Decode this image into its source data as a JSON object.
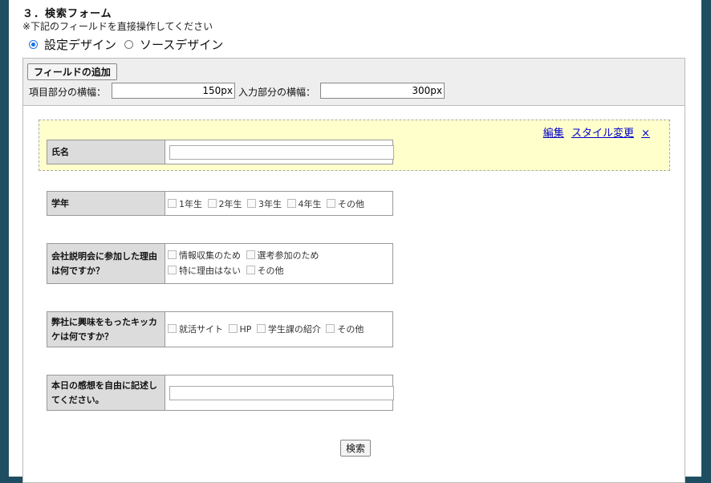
{
  "section_title": "３．検索フォーム",
  "note": "※下記のフィールドを直接操作してください",
  "mode": {
    "design": "設定デザイン",
    "source": "ソースデザイン",
    "selected": "design"
  },
  "toolbar": {
    "add_field": "フィールドの追加",
    "label_width_label": "項目部分の横幅：",
    "label_width_value": "150px",
    "input_width_label": "入力部分の横幅：",
    "input_width_value": "300px"
  },
  "field_actions": {
    "edit": "編集",
    "style": "スタイル変更",
    "close": "×"
  },
  "fields": [
    {
      "label": "氏名",
      "type": "text"
    },
    {
      "label": "学年",
      "type": "checkbox",
      "options": [
        [
          "1年生",
          "2年生",
          "3年生",
          "4年生",
          "その他"
        ]
      ]
    },
    {
      "label": "会社説明会に参加した理由は何ですか？",
      "type": "checkbox",
      "options": [
        [
          "情報収集のため",
          "選考参加のため"
        ],
        [
          "特に理由はない",
          "その他"
        ]
      ]
    },
    {
      "label": "弊社に興味をもったキッカケは何ですか？",
      "type": "checkbox",
      "options": [
        [
          "就活サイト",
          "HP",
          "学生課の紹介",
          "その他"
        ]
      ]
    },
    {
      "label": "本日の感想を自由に記述してください。",
      "type": "text"
    }
  ],
  "search_button": "検索"
}
